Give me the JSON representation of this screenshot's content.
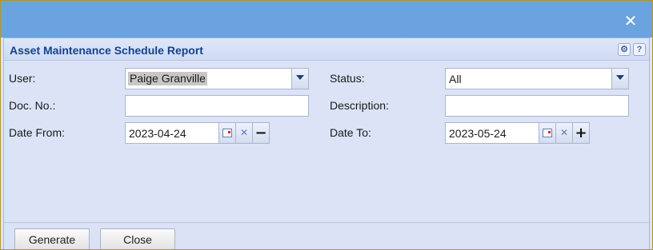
{
  "window": {
    "close_glyph": "✕"
  },
  "panel": {
    "title": "Asset Maintenance Schedule Report",
    "help_glyph": "?",
    "gear_glyph": "⚙"
  },
  "form": {
    "user": {
      "label": "User:",
      "value": "Paige Granville"
    },
    "status": {
      "label": "Status:",
      "value": "All"
    },
    "doc_no": {
      "label": "Doc. No.:",
      "value": ""
    },
    "description": {
      "label": "Description:",
      "value": ""
    },
    "date_from": {
      "label": "Date From:",
      "value": "2023-04-24",
      "toggle_glyph": "−"
    },
    "date_to": {
      "label": "Date To:",
      "value": "2023-05-24",
      "toggle_glyph": "+"
    },
    "clear_glyph": "✕"
  },
  "buttons": {
    "generate": "Generate",
    "close": "Close"
  },
  "icons": {
    "close": "close-icon",
    "gear": "gear-icon",
    "help": "help-icon",
    "calendar": "calendar-icon",
    "clear": "clear-icon",
    "chevron": "chevron-down-icon"
  }
}
